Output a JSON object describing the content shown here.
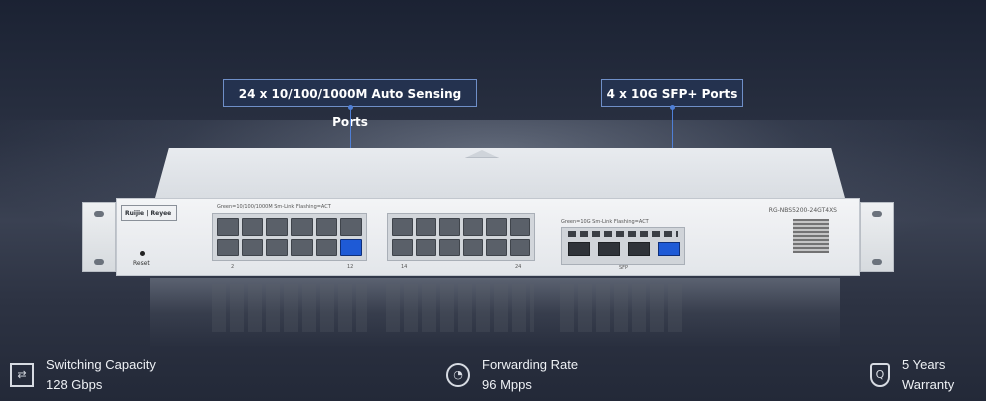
{
  "callouts": {
    "rj45": "24 x 10/100/1000M Auto Sensing Ports",
    "sfp": "4 x 10G SFP+ Ports"
  },
  "device": {
    "brand": "Ruijie | Reyee",
    "model": "RG-NBS5200-24GT4XS",
    "reset_label": "Reset",
    "port_labels": {
      "left_start": "2",
      "left_end": "12",
      "right_start": "14",
      "right_end": "24",
      "sfp": "SFP"
    },
    "rj45_group_label": "Green=10/100/1000M  Sm-Link  Flashing=ACT",
    "sfp_group_label": "Green=10G  Sm-Link  Flashing=ACT"
  },
  "features": [
    {
      "icon": "switching-icon",
      "title": "Switching Capacity",
      "value": "128 Gbps"
    },
    {
      "icon": "speedometer-icon",
      "title": "Forwarding Rate",
      "value": "96 Mpps"
    },
    {
      "icon": "shield-icon",
      "title": "5 Years",
      "value": "Warranty"
    }
  ]
}
